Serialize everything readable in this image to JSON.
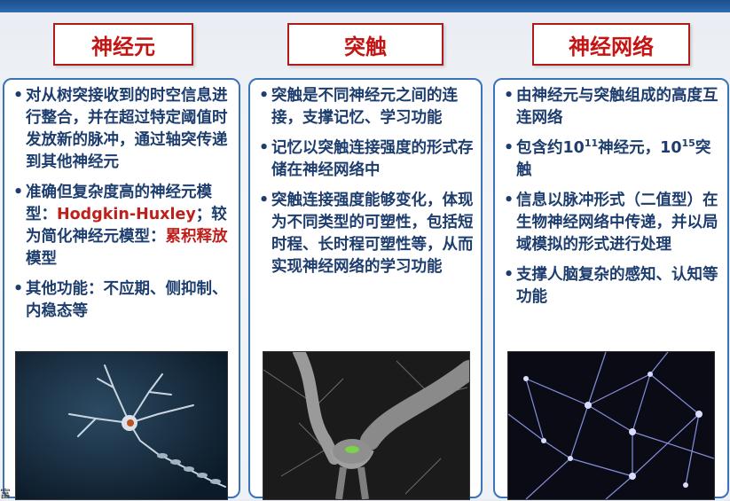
{
  "columns": [
    {
      "title": "神经元",
      "bullets": [
        {
          "parts": [
            "对从树突接收到的时空信息进行整合，并在超过特定阈值时发放新的脉冲，通过轴突传递到其他神经元"
          ]
        },
        {
          "parts": [
            "准确但复杂度高的神经元模型：",
            "Hodgkin-Huxley",
            "；较为简化神经元模型：",
            "累积释放",
            "模型"
          ]
        },
        {
          "parts": [
            "其他功能：不应期、侧抑制、内稳态等"
          ]
        }
      ],
      "image_icon": "neuron-illustration"
    },
    {
      "title": "突触",
      "bullets": [
        {
          "parts": [
            "突触是不同神经元之间的连接，支撑记忆、学习功能"
          ]
        },
        {
          "parts": [
            "记忆以突触连接强度的形式存储在神经网络中"
          ]
        },
        {
          "parts": [
            "突触连接强度能够变化，体现为不同类型的可塑性，包括短时程、长时程可塑性等，从而实现神经网络的学习功能"
          ]
        }
      ],
      "image_icon": "synapse-illustration"
    },
    {
      "title": "神经网络",
      "bullets": [
        {
          "parts": [
            "由神经元与突触组成的高度互连网络"
          ]
        },
        {
          "parts": [
            "包含约10",
            "11",
            "神经元，10",
            "15",
            "突触"
          ]
        },
        {
          "parts": [
            "信息以脉冲形式（二值型）在生物神经网络中传递，并以局域模拟的形式进行处理"
          ]
        },
        {
          "parts": [
            "支撑人脑复杂的感知、认知等功能"
          ]
        }
      ],
      "image_icon": "neural-network-illustration"
    }
  ],
  "corner_text": "富",
  "colors": {
    "title_red": "#c41515",
    "panel_border": "#3b72b8",
    "text_blue": "#1c3d6e",
    "highlight_red": "#c0201c"
  }
}
